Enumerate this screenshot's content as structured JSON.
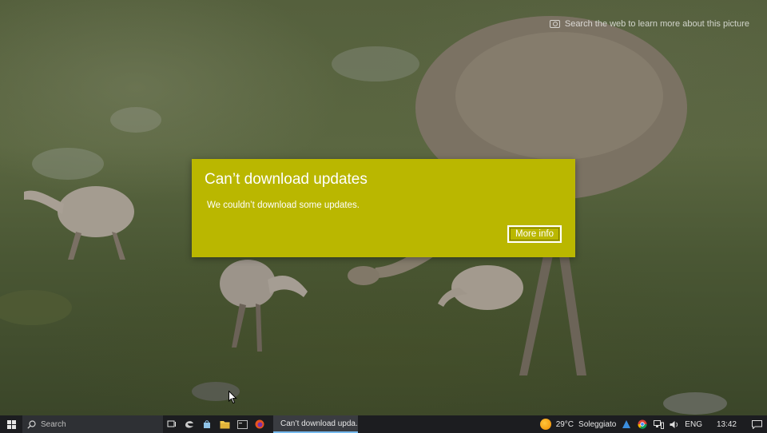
{
  "desktop": {
    "spotlight_text": "Search the web to learn more about this picture"
  },
  "dialog": {
    "title": "Can’t download updates",
    "message": "We couldn’t download some updates.",
    "more_info_label": "More info",
    "accent_color": "#bab700"
  },
  "taskbar": {
    "search_placeholder": "Search",
    "pinned_icons": [
      "task-view-icon",
      "edge-legacy-icon",
      "store-icon",
      "file-explorer-icon",
      "terminal-icon",
      "firefox-icon"
    ],
    "active_window_title": "Can’t download upda...",
    "weather": {
      "temperature": "29°C",
      "condition": "Soleggiato"
    },
    "language": "ENG",
    "time": "13:42"
  }
}
